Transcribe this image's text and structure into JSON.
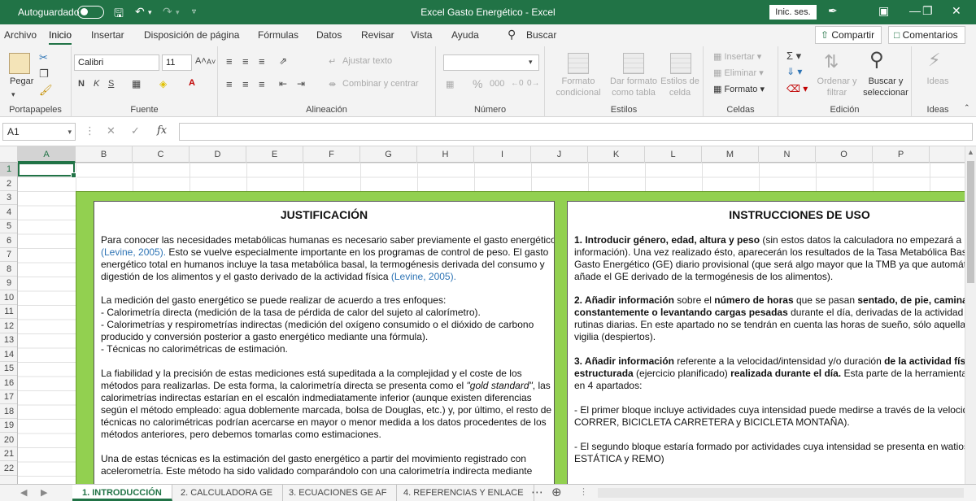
{
  "titlebar": {
    "autosave_label": "Autoguardado",
    "window_title": "Excel Gasto Energético  -  Excel",
    "signin_label": "Inic. ses."
  },
  "menu": {
    "tabs": [
      "Archivo",
      "Inicio",
      "Insertar",
      "Disposición de página",
      "Fórmulas",
      "Datos",
      "Revisar",
      "Vista",
      "Ayuda"
    ],
    "search_label": "Buscar",
    "share_label": "Compartir",
    "comments_label": "Comentarios"
  },
  "ribbon": {
    "paste_label": "Pegar",
    "font_name": "Calibri",
    "font_size": "11",
    "wrap_label": "Ajustar texto",
    "merge_label": "Combinar y centrar",
    "cond_format_l1": "Formato",
    "cond_format_l2": "condicional",
    "table_format_l1": "Dar formato",
    "table_format_l2": "como tabla",
    "cell_styles_l1": "Estilos de",
    "cell_styles_l2": "celda",
    "insert_label": "Insertar",
    "delete_label": "Eliminar",
    "format_label": "Formato",
    "sort_l1": "Ordenar y",
    "sort_l2": "filtrar",
    "find_l1": "Buscar y",
    "find_l2": "seleccionar",
    "ideas_label": "Ideas",
    "groups": {
      "clipboard": "Portapapeles",
      "font": "Fuente",
      "alignment": "Alineación",
      "number": "Número",
      "styles": "Estilos",
      "cells": "Celdas",
      "editing": "Edición",
      "ideas": "Ideas"
    }
  },
  "formula_bar": {
    "name_box": "A1",
    "fx_label": "fx"
  },
  "columns": [
    "A",
    "B",
    "C",
    "D",
    "E",
    "F",
    "G",
    "H",
    "I",
    "J",
    "K",
    "L",
    "M",
    "N",
    "O",
    "P"
  ],
  "rows": [
    "1",
    "2",
    "3",
    "4",
    "5",
    "6",
    "7",
    "8",
    "9",
    "10",
    "11",
    "12",
    "13",
    "14",
    "15",
    "16",
    "17",
    "18",
    "19",
    "20",
    "21",
    "22"
  ],
  "justificacion": {
    "title": "JUSTIFICACIÓN",
    "p1_l1": "Para conocer las necesidades metabólicas humanas es necesario saber previamente el gasto energético",
    "p1_l2_link": "(Levine, 2005).",
    "p1_l2": " Esto se vuelve especialmente importante en los programas de control de peso. El gasto",
    "p1_l3": "energético total en humanos incluye la tasa metabólica basal, la termogénesis derivada del consumo y",
    "p1_l4": "digestión de los alimentos y el gasto derivado de la actividad física ",
    "p1_l4_link": "(Levine, 2005).",
    "p2_l1": "La medición del gasto energético se puede realizar de acuerdo a tres enfoques:",
    "p2_l2": "- Calorimetría directa (medición de la tasa de pérdida de calor del sujeto al calorímetro).",
    "p2_l3": "- Calorimetrías y respirometrías indirectas (medición del oxígeno consumido o el dióxido de carbono",
    "p2_l4": "producido y conversión posterior a gasto energético mediante una fórmula).",
    "p2_l5": "- Técnicas no calorimétricas de estimación.",
    "p3_l1": "La fiabilidad y la precisión de estas mediciones está supeditada a la complejidad y el coste de los",
    "p3_l2a": "métodos para realizarlas. De esta forma, la calorimetría directa se presenta como el ",
    "p3_l2i": "\"gold standard\"",
    "p3_l2b": ", las",
    "p3_l3": "calorimetrías indirectas estarían en el escalón indmediatamente inferior (aunque existen diferencias",
    "p3_l4": "según el método empleado: agua doblemente marcada, bolsa de Douglas, etc.) y, por último, el resto de",
    "p3_l5": "técnicas no calorimétricas podrían acercarse en mayor o menor medida a los datos procedentes de los",
    "p3_l6": "métodos anteriores, pero debemos tomarlas como estimaciones.",
    "p4_l1": "Una de estas técnicas es la estimación del gasto energético a partir del movimiento registrado con",
    "p4_l2": "acelerometría. Este método ha sido validado comparándolo con una calorimetría indirecta mediante"
  },
  "instrucciones": {
    "title": "INSTRUCCIONES DE USO",
    "s1_l1b": "1. Introducir género, edad, altura y peso",
    "s1_l1": " (sin estos datos la calculadora no empezará a arro",
    "s1_l2": "información). Una vez realizado ésto, aparecerán los resultados de la Tasa Metabólica Basa",
    "s1_l3": "Gasto Energético (GE) diario provisional (que será algo mayor que la TMB ya que automátic",
    "s1_l4": "añade el GE derivado de la termogénesis de los alimentos).",
    "s2_l1b": "2. Añadir información",
    "s2_l1": " sobre el ",
    "s2_l1b2": "número de horas",
    "s2_l1c": " que se pasan ",
    "s2_l1b3": "sentado, de pie, caminando",
    "s2_l2b": "constantemente o levantando cargas pesadas",
    "s2_l2": " durante el día, derivadas de la actividad labo",
    "s2_l3": "rutinas diarias. En este apartado no se tendrán en cuenta las horas de sueño, sólo aquellas",
    "s2_l4": "vigilia (despiertos).",
    "s3_l1b": "3. Añadir información",
    "s3_l1": " referente a la velocidad/intensidad y/o duración ",
    "s3_l1b2": "de la actividad físic",
    "s3_l2b": "estructurada",
    "s3_l2": " (ejercicio planificado) ",
    "s3_l2b2": "realizada durante el día.",
    "s3_l2c": " Esta parte de la herramienta E",
    "s3_l3": "en 4 apartados:",
    "s4_l1": "- El primer bloque incluye actividades cuya intensidad puede medirse a través de la velocid",
    "s4_l2": "CORRER, BICICLETA CARRETERA y BICICLETA MONTAÑA).",
    "s5_l1": "- El segundo bloque estaría formado por actividades cuya intensidad se presenta en watios",
    "s5_l2": "ESTÁTICA y REMO)"
  },
  "sheet_tabs": [
    "1. INTRODUCCIÓN",
    "2. CALCULADORA GE",
    "3. ECUACIONES GE AF",
    "4. REFERENCIAS Y ENLACE"
  ],
  "colors": {
    "excel_green": "#217346",
    "band_green": "#92d050",
    "link_blue": "#2e74b5"
  }
}
